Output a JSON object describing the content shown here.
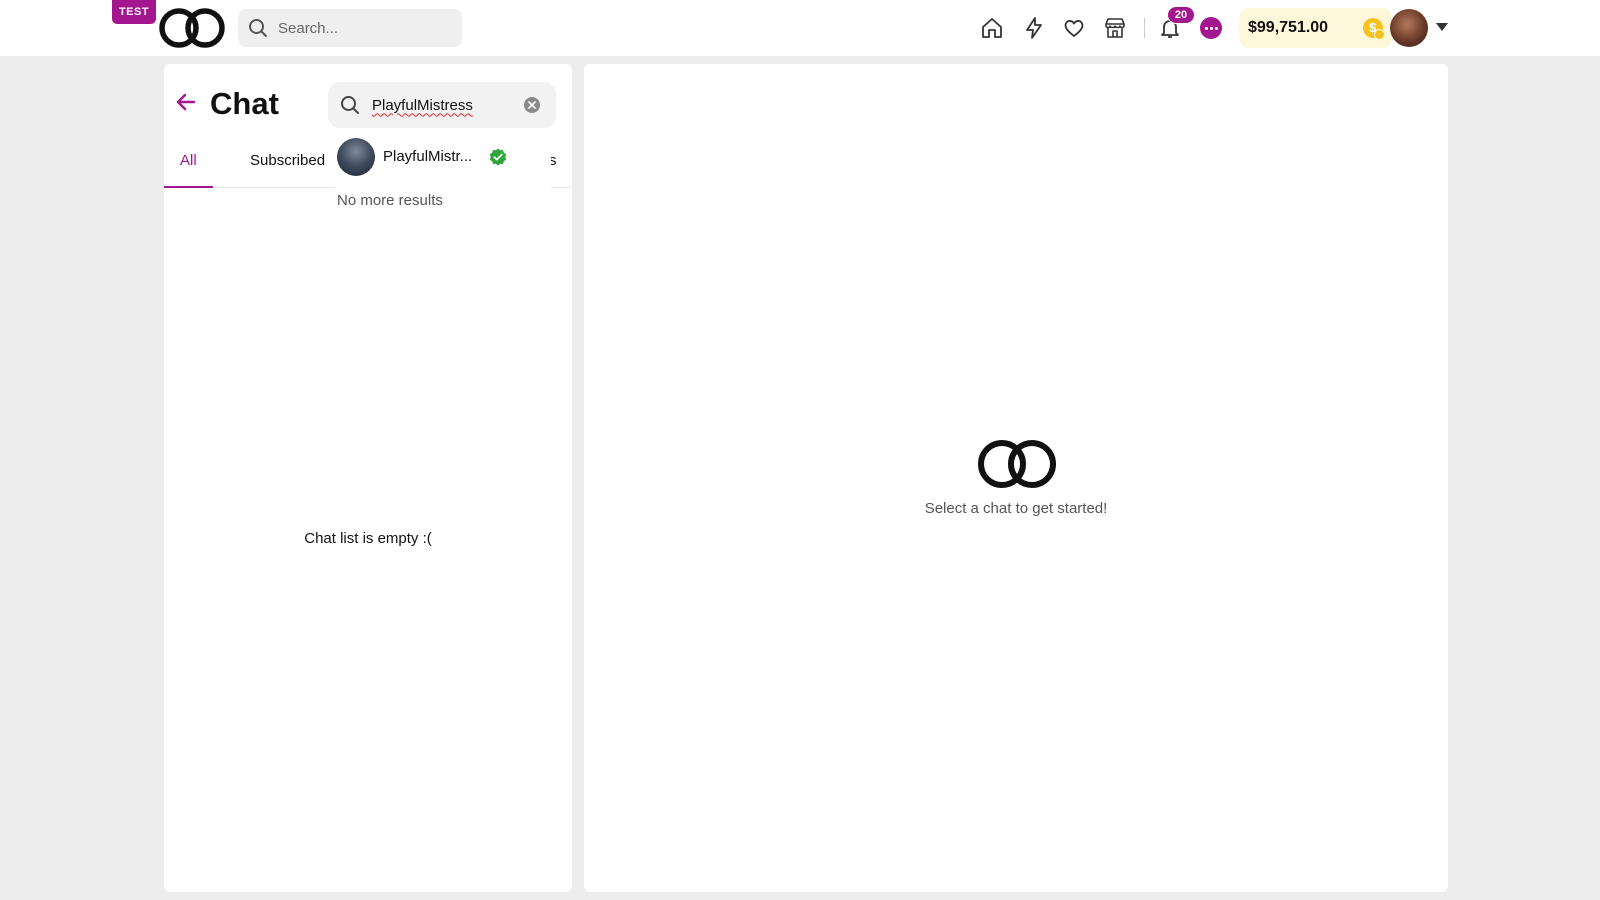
{
  "topbar": {
    "test_badge": "TEST",
    "search_placeholder": "Search...",
    "notification_count": "20",
    "balance": "$99,751.00",
    "icons": [
      "home-icon",
      "lightning-icon",
      "heart-icon",
      "store-icon",
      "bell-icon",
      "chat-icon",
      "coin-icon"
    ]
  },
  "chat_panel": {
    "title": "Chat",
    "search_value": "PlayfulMistress",
    "tabs": [
      {
        "label": "All",
        "active": true
      },
      {
        "label": "Subscribed",
        "active": false
      },
      {
        "label": "s",
        "active": false
      }
    ],
    "results": [
      {
        "name": "PlayfulMistr...",
        "verified": true
      }
    ],
    "no_more_results": "No more results",
    "empty_message": "Chat list is empty :("
  },
  "main_panel": {
    "placeholder_message": "Select a chat to get started!"
  },
  "colors": {
    "accent": "#a4168d",
    "verified": "#2fa63a",
    "coin": "#f6c21b",
    "balance_bg": "#fff7dc"
  }
}
